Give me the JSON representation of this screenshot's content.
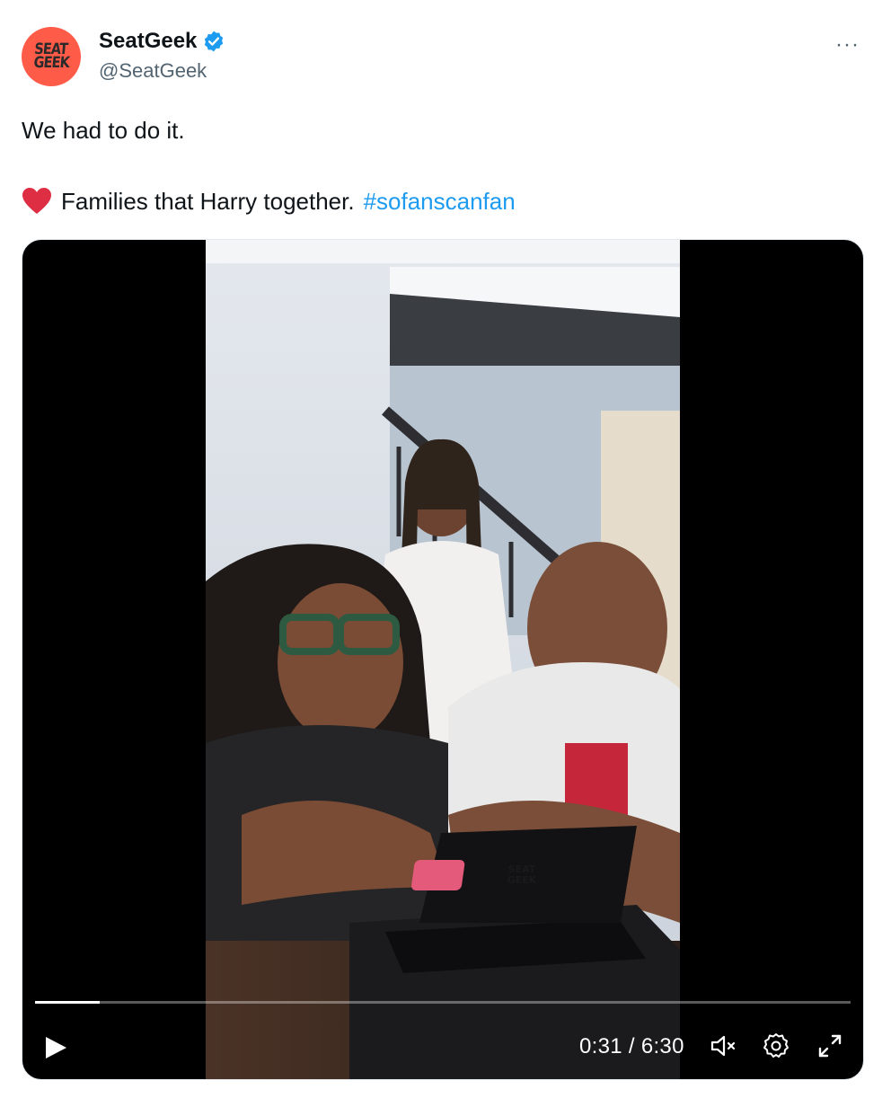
{
  "author": {
    "avatar_line1": "SEAT",
    "avatar_line2": "GEEK",
    "name": "SeatGeek",
    "handle": "@SeatGeek",
    "verified_icon": "verified-badge-icon",
    "avatar_color": "#ff5b49"
  },
  "menu": {
    "more_label": "···"
  },
  "tweet": {
    "line1": "We had to do it.",
    "emoji_icon": "red-heart-icon",
    "line2": "Families that Harry together.",
    "hashtag": "#sofanscanfan",
    "hashtag_color": "#1d9bf0"
  },
  "video": {
    "card_label_line1": "SEAT",
    "card_label_line2": "GEEK",
    "current_time": "0:31",
    "duration": "6:30",
    "time_display": "0:31 / 6:30",
    "progress_fraction": 0.0795,
    "controls": [
      "play-icon",
      "muted-speaker-icon",
      "settings-gear-icon",
      "fullscreen-icon"
    ]
  }
}
